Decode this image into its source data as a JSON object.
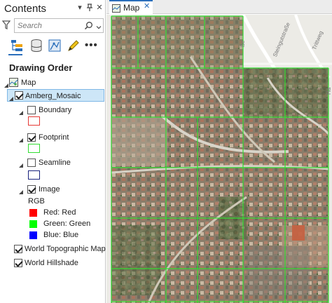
{
  "contents": {
    "title": "Contents",
    "search_placeholder": "Search",
    "drawing_order_title": "Drawing Order",
    "toolbar_more": "•••",
    "header_buttons": {
      "menu": "▾",
      "pin": "⊓",
      "close": "✕"
    }
  },
  "layers": {
    "map": {
      "label": "Map"
    },
    "mosaic": {
      "label": "Amberg_Mosaic",
      "checked": true,
      "selected": true
    },
    "boundary": {
      "label": "Boundary",
      "checked": false,
      "swatch_color": "#e53935"
    },
    "footprint": {
      "label": "Footprint",
      "checked": true,
      "swatch_color": "#33dd33"
    },
    "seamline": {
      "label": "Seamline",
      "checked": false,
      "swatch_color": "#1a237e"
    },
    "image": {
      "label": "Image",
      "checked": true,
      "rgb_title": "RGB",
      "bands": [
        {
          "label": "Red:  Red",
          "color": "#ff0000"
        },
        {
          "label": "Green: Green",
          "color": "#00ff00"
        },
        {
          "label": "Blue:  Blue",
          "color": "#0000ff"
        }
      ]
    },
    "topographic": {
      "label": "World Topographic Map",
      "checked": true
    },
    "hillshade": {
      "label": "World Hillshade",
      "checked": true
    }
  },
  "map_view": {
    "tab_label": "Map",
    "footprint_color": "#33dd33",
    "street_labels": [
      "Steingutstraße",
      "Trittweg",
      "ße",
      "Ha"
    ]
  }
}
